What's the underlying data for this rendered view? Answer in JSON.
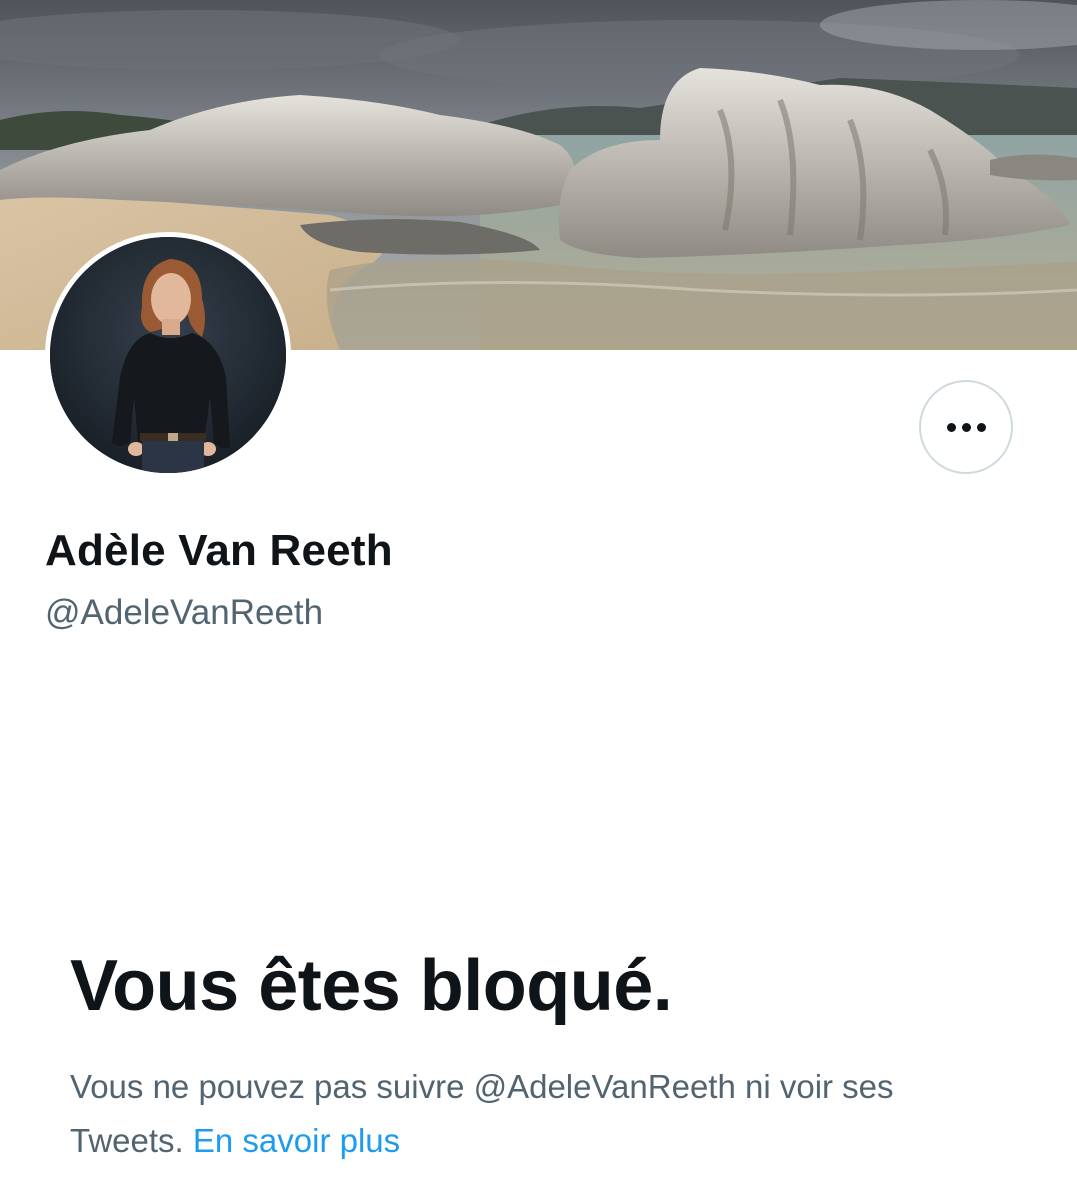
{
  "profile": {
    "display_name": "Adèle Van Reeth",
    "handle": "@AdeleVanReeth"
  },
  "blocked": {
    "title": "Vous êtes bloqué.",
    "description": "Vous ne pouvez pas suivre @AdeleVanReeth ni voir ses Tweets.",
    "learn_more": "En savoir plus"
  },
  "icons": {
    "more": "more-horizontal-icon"
  },
  "colors": {
    "text_primary": "#0f1419",
    "text_secondary": "#536471",
    "link": "#1d9bf0",
    "border": "#cfd9de"
  }
}
